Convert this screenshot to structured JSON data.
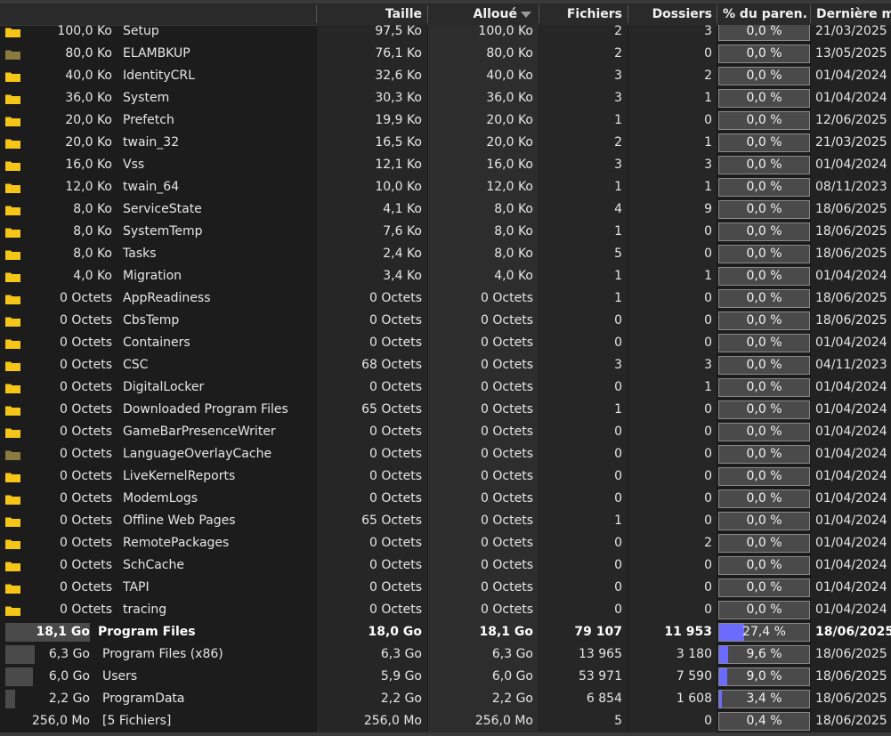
{
  "columns": {
    "size": "Taille",
    "allocated": "Alloué",
    "files": "Fichiers",
    "folders": "Dossiers",
    "parent_pct": "% du paren...",
    "modified": "Dernière mo"
  },
  "rows": [
    {
      "alloc_left": "100,0 Ko",
      "name": "Setup",
      "size": "97,5 Ko",
      "alloc": "100,0 Ko",
      "files": "2",
      "folders": "3",
      "pct": "0,0 %",
      "date": "21/03/2025"
    },
    {
      "alloc_left": "80,0 Ko",
      "name": "ELAMBKUP",
      "size": "76,1 Ko",
      "alloc": "80,0 Ko",
      "files": "2",
      "folders": "0",
      "pct": "0,0 %",
      "date": "13/05/2025",
      "icon": "folder-dim"
    },
    {
      "alloc_left": "40,0 Ko",
      "name": "IdentityCRL",
      "size": "32,6 Ko",
      "alloc": "40,0 Ko",
      "files": "3",
      "folders": "2",
      "pct": "0,0 %",
      "date": "01/04/2024"
    },
    {
      "alloc_left": "36,0 Ko",
      "name": "System",
      "size": "30,3 Ko",
      "alloc": "36,0 Ko",
      "files": "3",
      "folders": "1",
      "pct": "0,0 %",
      "date": "01/04/2024"
    },
    {
      "alloc_left": "20,0 Ko",
      "name": "Prefetch",
      "size": "19,9 Ko",
      "alloc": "20,0 Ko",
      "files": "1",
      "folders": "0",
      "pct": "0,0 %",
      "date": "12/06/2025"
    },
    {
      "alloc_left": "20,0 Ko",
      "name": "twain_32",
      "size": "16,5 Ko",
      "alloc": "20,0 Ko",
      "files": "2",
      "folders": "1",
      "pct": "0,0 %",
      "date": "21/03/2025"
    },
    {
      "alloc_left": "16,0 Ko",
      "name": "Vss",
      "size": "12,1 Ko",
      "alloc": "16,0 Ko",
      "files": "3",
      "folders": "3",
      "pct": "0,0 %",
      "date": "01/04/2024"
    },
    {
      "alloc_left": "12,0 Ko",
      "name": "twain_64",
      "size": "10,0 Ko",
      "alloc": "12,0 Ko",
      "files": "1",
      "folders": "1",
      "pct": "0,0 %",
      "date": "08/11/2023"
    },
    {
      "alloc_left": "8,0 Ko",
      "name": "ServiceState",
      "size": "4,1 Ko",
      "alloc": "8,0 Ko",
      "files": "4",
      "folders": "9",
      "pct": "0,0 %",
      "date": "18/06/2025"
    },
    {
      "alloc_left": "8,0 Ko",
      "name": "SystemTemp",
      "size": "7,6 Ko",
      "alloc": "8,0 Ko",
      "files": "1",
      "folders": "0",
      "pct": "0,0 %",
      "date": "18/06/2025"
    },
    {
      "alloc_left": "8,0 Ko",
      "name": "Tasks",
      "size": "2,4 Ko",
      "alloc": "8,0 Ko",
      "files": "5",
      "folders": "0",
      "pct": "0,0 %",
      "date": "18/06/2025"
    },
    {
      "alloc_left": "4,0 Ko",
      "name": "Migration",
      "size": "3,4 Ko",
      "alloc": "4,0 Ko",
      "files": "1",
      "folders": "1",
      "pct": "0,0 %",
      "date": "01/04/2024"
    },
    {
      "alloc_left": "0 Octets",
      "name": "AppReadiness",
      "size": "0 Octets",
      "alloc": "0 Octets",
      "files": "1",
      "folders": "0",
      "pct": "0,0 %",
      "date": "18/06/2025"
    },
    {
      "alloc_left": "0 Octets",
      "name": "CbsTemp",
      "size": "0 Octets",
      "alloc": "0 Octets",
      "files": "0",
      "folders": "0",
      "pct": "0,0 %",
      "date": "18/06/2025"
    },
    {
      "alloc_left": "0 Octets",
      "name": "Containers",
      "size": "0 Octets",
      "alloc": "0 Octets",
      "files": "0",
      "folders": "0",
      "pct": "0,0 %",
      "date": "01/04/2024"
    },
    {
      "alloc_left": "0 Octets",
      "name": "CSC",
      "size": "68 Octets",
      "alloc": "0 Octets",
      "files": "3",
      "folders": "3",
      "pct": "0,0 %",
      "date": "04/11/2023"
    },
    {
      "alloc_left": "0 Octets",
      "name": "DigitalLocker",
      "size": "0 Octets",
      "alloc": "0 Octets",
      "files": "0",
      "folders": "1",
      "pct": "0,0 %",
      "date": "01/04/2024"
    },
    {
      "alloc_left": "0 Octets",
      "name": "Downloaded Program Files",
      "size": "65 Octets",
      "alloc": "0 Octets",
      "files": "1",
      "folders": "0",
      "pct": "0,0 %",
      "date": "01/04/2024"
    },
    {
      "alloc_left": "0 Octets",
      "name": "GameBarPresenceWriter",
      "size": "0 Octets",
      "alloc": "0 Octets",
      "files": "0",
      "folders": "0",
      "pct": "0,0 %",
      "date": "01/04/2024"
    },
    {
      "alloc_left": "0 Octets",
      "name": "LanguageOverlayCache",
      "size": "0 Octets",
      "alloc": "0 Octets",
      "files": "0",
      "folders": "0",
      "pct": "0,0 %",
      "date": "01/04/2024",
      "icon": "folder-dim"
    },
    {
      "alloc_left": "0 Octets",
      "name": "LiveKernelReports",
      "size": "0 Octets",
      "alloc": "0 Octets",
      "files": "0",
      "folders": "0",
      "pct": "0,0 %",
      "date": "01/04/2024"
    },
    {
      "alloc_left": "0 Octets",
      "name": "ModemLogs",
      "size": "0 Octets",
      "alloc": "0 Octets",
      "files": "0",
      "folders": "0",
      "pct": "0,0 %",
      "date": "01/04/2024"
    },
    {
      "alloc_left": "0 Octets",
      "name": "Offline Web Pages",
      "size": "65 Octets",
      "alloc": "0 Octets",
      "files": "1",
      "folders": "0",
      "pct": "0,0 %",
      "date": "01/04/2024"
    },
    {
      "alloc_left": "0 Octets",
      "name": "RemotePackages",
      "size": "0 Octets",
      "alloc": "0 Octets",
      "files": "0",
      "folders": "2",
      "pct": "0,0 %",
      "date": "01/04/2024"
    },
    {
      "alloc_left": "0 Octets",
      "name": "SchCache",
      "size": "0 Octets",
      "alloc": "0 Octets",
      "files": "0",
      "folders": "0",
      "pct": "0,0 %",
      "date": "01/04/2024"
    },
    {
      "alloc_left": "0 Octets",
      "name": "TAPI",
      "size": "0 Octets",
      "alloc": "0 Octets",
      "files": "0",
      "folders": "0",
      "pct": "0,0 %",
      "date": "01/04/2024"
    },
    {
      "alloc_left": "0 Octets",
      "name": "tracing",
      "size": "0 Octets",
      "alloc": "0 Octets",
      "files": "0",
      "folders": "0",
      "pct": "0,0 %",
      "date": "01/04/2024"
    },
    {
      "alloc_left": "18,1 Go",
      "name": "Program Files",
      "size": "18,0 Go",
      "alloc": "18,1 Go",
      "files": "79 107",
      "folders": "11 953",
      "pct": "27,4 %",
      "pct_value": 27.4,
      "size_share": 1.0,
      "date": "18/06/2025",
      "bold": true,
      "level": 1
    },
    {
      "alloc_left": "6,3 Go",
      "name": "Program Files (x86)",
      "size": "6,3 Go",
      "alloc": "6,3 Go",
      "files": "13 965",
      "folders": "3 180",
      "pct": "9,6 %",
      "pct_value": 9.6,
      "size_share": 0.35,
      "date": "18/06/2025",
      "level": 1
    },
    {
      "alloc_left": "6,0 Go",
      "name": "Users",
      "size": "5,9 Go",
      "alloc": "6,0 Go",
      "files": "53 971",
      "folders": "7 590",
      "pct": "9,0 %",
      "pct_value": 9.0,
      "size_share": 0.33,
      "date": "18/06/2025",
      "level": 1
    },
    {
      "alloc_left": "2,2 Go",
      "name": "ProgramData",
      "size": "2,2 Go",
      "alloc": "2,2 Go",
      "files": "6 854",
      "folders": "1 608",
      "pct": "3,4 %",
      "pct_value": 3.4,
      "size_share": 0.12,
      "date": "18/06/2025",
      "level": 1
    },
    {
      "alloc_left": "256,0 Mo",
      "name": "[5 Fichiers]",
      "size": "256,0 Mo",
      "alloc": "256,0 Mo",
      "files": "5",
      "folders": "0",
      "pct": "0,4 %",
      "pct_value": 0.4,
      "size_share": 0.0,
      "date": "18/06/2025",
      "level": 1,
      "icon": "none"
    }
  ],
  "colors": {
    "background": "#1c1c1c",
    "header": "#2a2a2a",
    "pct_bar": "#6b6bff",
    "folder_icon": "#f5c518",
    "folder_icon_dim": "#8a7a40"
  }
}
